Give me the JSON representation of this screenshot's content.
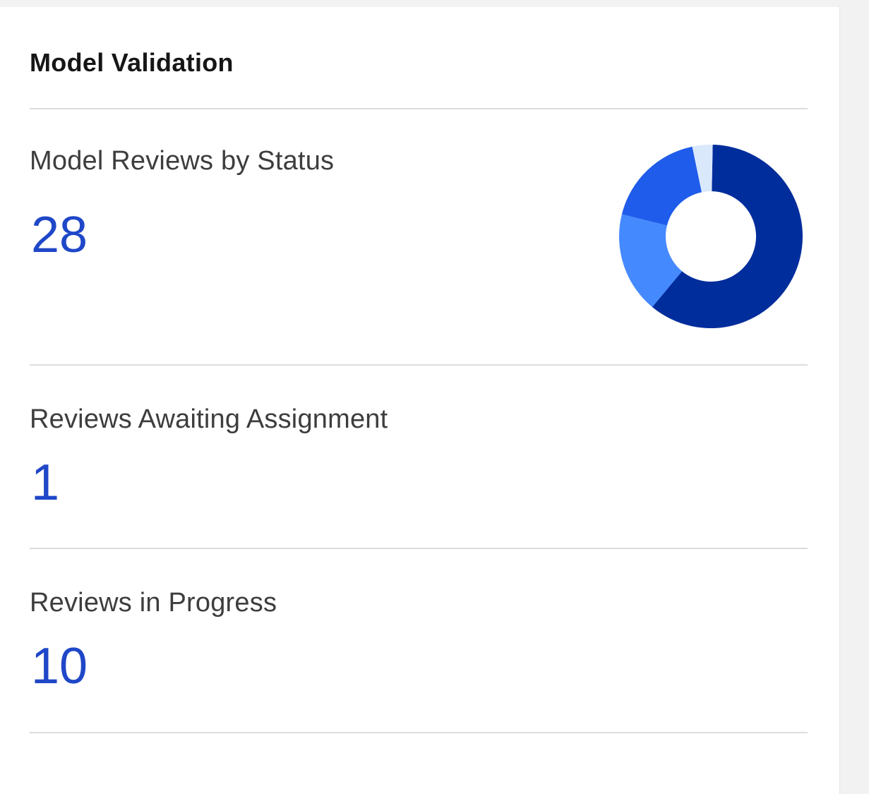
{
  "widget": {
    "title": "Model Validation"
  },
  "metrics": [
    {
      "label": "Model Reviews by Status",
      "value": "28"
    },
    {
      "label": "Reviews Awaiting Assignment",
      "value": "1"
    },
    {
      "label": "Reviews in Progress",
      "value": "10"
    }
  ],
  "chart_data": {
    "type": "pie",
    "values": [
      17,
      5,
      5,
      1
    ],
    "colors": [
      "#002d9c",
      "#4589ff",
      "#1f5ceb",
      "#d9e8fb"
    ],
    "donut": true
  }
}
